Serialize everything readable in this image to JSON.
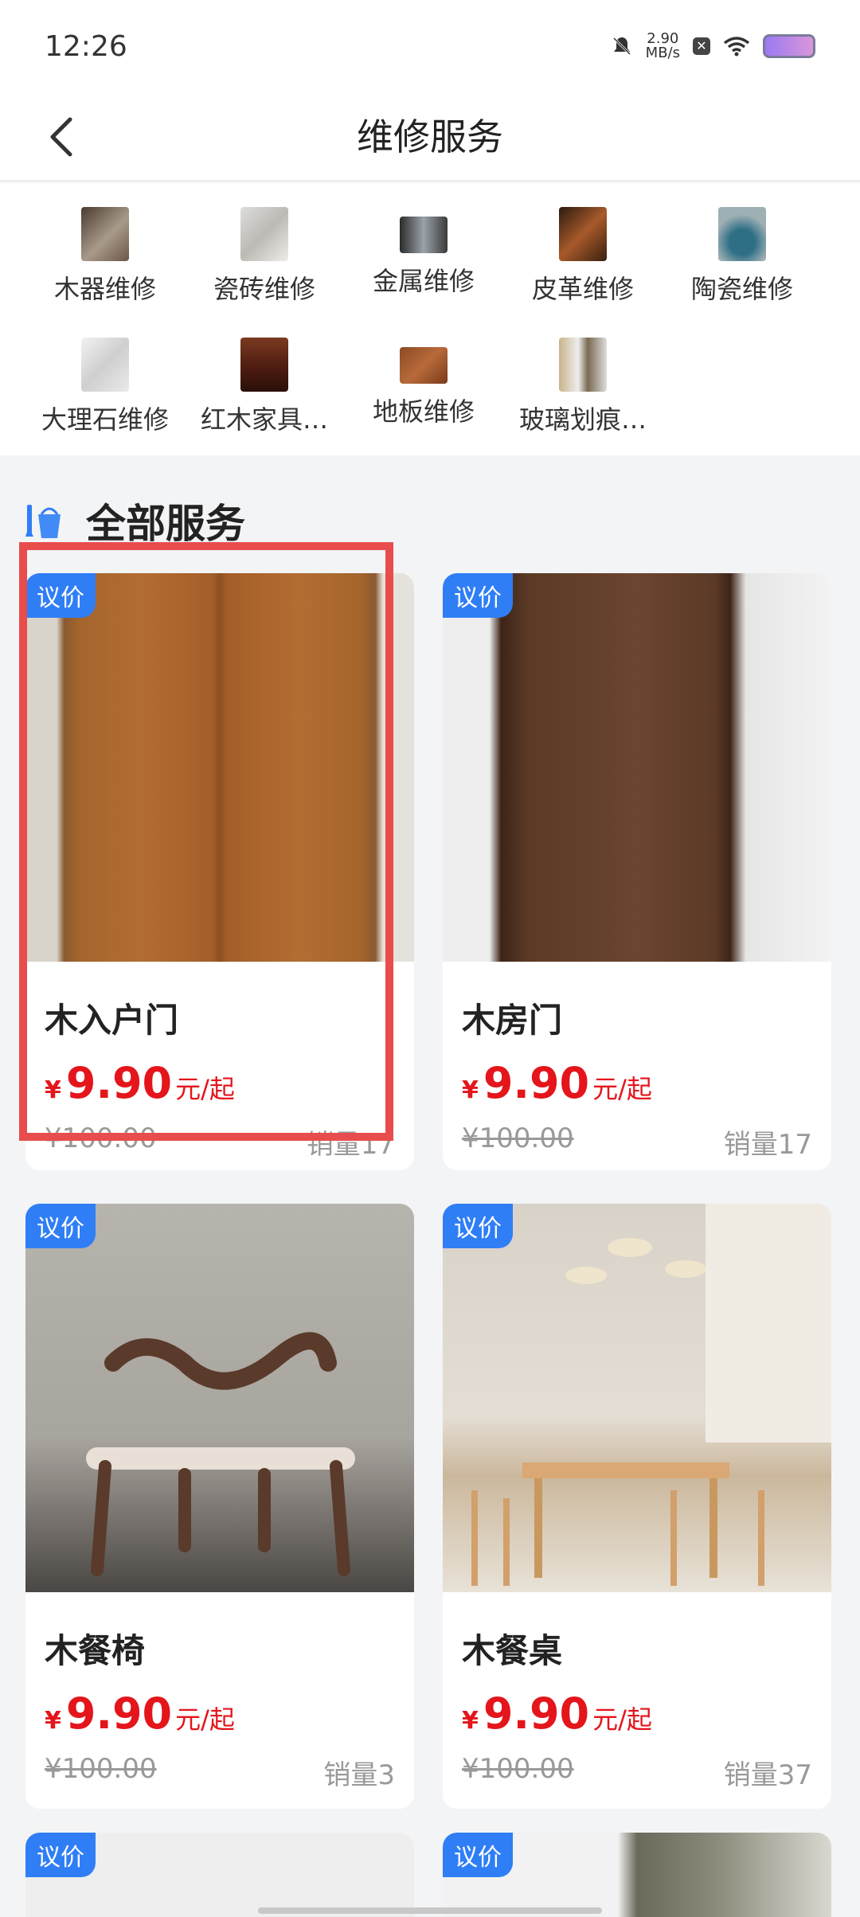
{
  "status": {
    "time": "12:26",
    "speed": "2.90",
    "speed_unit": "MB/s"
  },
  "header": {
    "title": "维修服务",
    "back_icon": "chevron-left-icon"
  },
  "categories": [
    {
      "label": "木器维修"
    },
    {
      "label": "瓷砖维修"
    },
    {
      "label": "金属维修"
    },
    {
      "label": "皮革维修"
    },
    {
      "label": "陶瓷维修"
    },
    {
      "label": "大理石维修"
    },
    {
      "label": "红木家具…"
    },
    {
      "label": "地板维修"
    },
    {
      "label": "玻璃划痕…"
    }
  ],
  "section": {
    "title": "全部服务",
    "icon": "cleaning-bucket-icon"
  },
  "products": [
    {
      "tag": "议价",
      "name": "木入户门",
      "currency": "¥",
      "price": "9.90",
      "unit": "元/起",
      "old_price": "¥100.00",
      "sales": "销量17"
    },
    {
      "tag": "议价",
      "name": "木房门",
      "currency": "¥",
      "price": "9.90",
      "unit": "元/起",
      "old_price": "¥100.00",
      "sales": "销量17"
    },
    {
      "tag": "议价",
      "name": "木餐椅",
      "currency": "¥",
      "price": "9.90",
      "unit": "元/起",
      "old_price": "¥100.00",
      "sales": "销量3"
    },
    {
      "tag": "议价",
      "name": "木餐桌",
      "currency": "¥",
      "price": "9.90",
      "unit": "元/起",
      "old_price": "¥100.00",
      "sales": "销量37"
    },
    {
      "tag": "议价"
    },
    {
      "tag": "议价"
    }
  ],
  "colors": {
    "accent": "#2f7ef6",
    "price": "#e4151b",
    "highlight": "#e94c4c"
  }
}
